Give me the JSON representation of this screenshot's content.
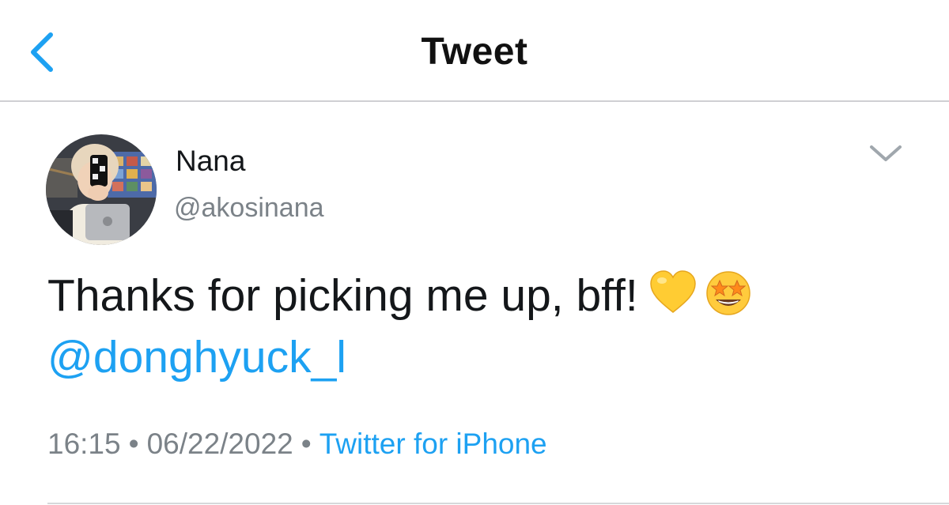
{
  "nav": {
    "title": "Tweet",
    "back_icon": "chevron-left-icon",
    "accent": "#1da1f2"
  },
  "tweet": {
    "author": {
      "name": "Nana",
      "handle": "@akosinana"
    },
    "text": "Thanks for picking me up, bff!",
    "emojis": [
      "yellow-heart-icon",
      "star-struck-icon"
    ],
    "mention": "@donghyuck_l",
    "time": "16:15",
    "separator": "•",
    "date": "06/22/2022",
    "source": "Twitter for iPhone",
    "menu_icon": "chevron-down-icon"
  },
  "colors": {
    "text": "#14171a",
    "secondary": "#7b8288",
    "link": "#1da1f2",
    "heart": "#ffcc33",
    "divider": "#cfcfd3"
  }
}
